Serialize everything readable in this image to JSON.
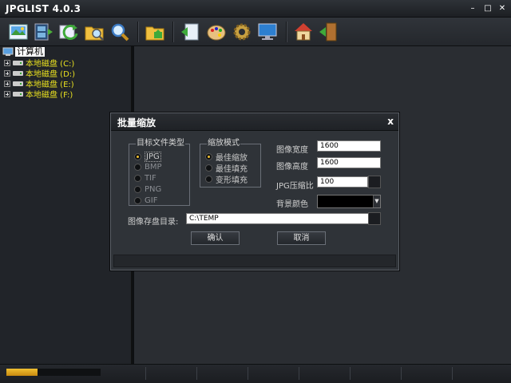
{
  "window": {
    "title": "JPGLIST 4.0.3"
  },
  "tree": {
    "root_label": "计算机",
    "drives": [
      {
        "label": "本地磁盘 (C:)"
      },
      {
        "label": "本地磁盘 (D:)"
      },
      {
        "label": "本地磁盘 (E:)"
      },
      {
        "label": "本地磁盘 (F:)"
      }
    ]
  },
  "dialog": {
    "title": "批量缩放",
    "close_label": "x",
    "file_type_group": {
      "legend": "目标文件类型",
      "options": [
        "JPG",
        "BMP",
        "TIF",
        "PNG",
        "GIF"
      ],
      "selected": "JPG"
    },
    "scale_mode_group": {
      "legend": "缩放模式",
      "options": [
        "最佳缩放",
        "最佳填充",
        "变形填充"
      ],
      "selected": "最佳缩放"
    },
    "width_label": "图像宽度",
    "width_value": "1600",
    "height_label": "图像高度",
    "height_value": "1600",
    "jpg_quality_label": "JPG压缩比",
    "jpg_quality_value": "100",
    "bg_color_label": "背景颜色",
    "bg_color": "#000000",
    "save_dir_label": "图像存盘目录:",
    "save_dir_value": "C:\\TEMP",
    "ok_label": "确认",
    "cancel_label": "取消"
  },
  "status": {
    "progress": 0.33
  },
  "colors": {
    "accent": "#f0c030",
    "background": "#1a1d21",
    "drive_text": "#e8e020"
  }
}
